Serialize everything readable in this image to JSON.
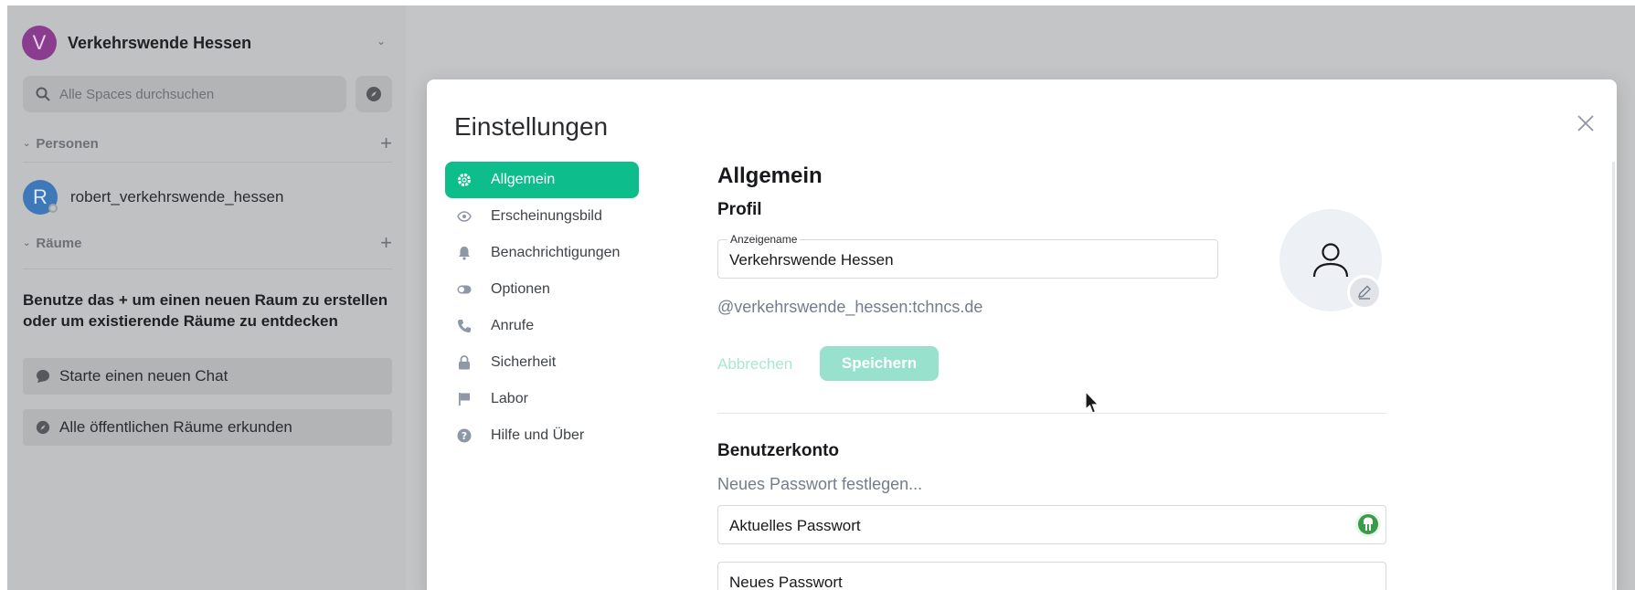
{
  "space": {
    "initial": "V",
    "name": "Verkehrswende Hessen"
  },
  "search": {
    "placeholder": "Alle Spaces durchsuchen"
  },
  "sections": {
    "people": "Personen",
    "rooms": "Räume"
  },
  "people": [
    {
      "initial": "R",
      "name": "robert_verkehrswende_hessen"
    }
  ],
  "rooms_hint": "Benutze das + um einen neuen Raum zu erstellen oder um existierende Räume zu entdecken",
  "actions": {
    "new_chat": "Starte einen neuen Chat",
    "explore": "Alle öffentlichen Räume erkunden"
  },
  "modal": {
    "title": "Einstellungen",
    "nav": [
      {
        "label": "Allgemein",
        "icon": "gear-icon",
        "active": true
      },
      {
        "label": "Erscheinungsbild",
        "icon": "eye-icon"
      },
      {
        "label": "Benachrichtigungen",
        "icon": "bell-icon"
      },
      {
        "label": "Optionen",
        "icon": "toggle-icon"
      },
      {
        "label": "Anrufe",
        "icon": "phone-icon"
      },
      {
        "label": "Sicherheit",
        "icon": "lock-icon"
      },
      {
        "label": "Labor",
        "icon": "flag-icon"
      },
      {
        "label": "Hilfe und Über",
        "icon": "help-icon"
      }
    ],
    "general": {
      "heading": "Allgemein",
      "profile_heading": "Profil",
      "display_name_label": "Anzeigename",
      "display_name_value": "Verkehrswende Hessen",
      "mxid": "@verkehrswende_hessen:tchncs.de",
      "cancel": "Abbrechen",
      "save": "Speichern",
      "account_heading": "Benutzerkonto",
      "set_password_link": "Neues Passwort festlegen...",
      "current_password": "Aktuelles Passwort",
      "new_password": "Neues Passwort"
    }
  },
  "colors": {
    "accent": "#0dbd8b",
    "space_avatar": "#8a3d8f",
    "user_avatar": "#3e78b8"
  }
}
